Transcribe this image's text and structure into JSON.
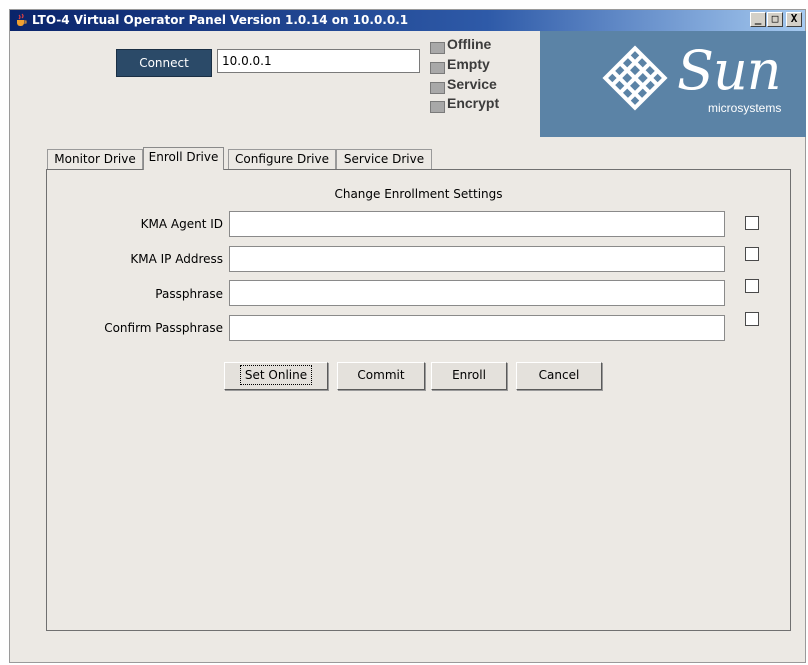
{
  "window": {
    "title": "LTO-4 Virtual Operator Panel Version 1.0.14 on 10.0.0.1",
    "controls": [
      "_",
      "□",
      "X"
    ]
  },
  "connection": {
    "connect_label": "Connect",
    "ip_value": "10.0.0.1"
  },
  "status": [
    {
      "label": "Offline"
    },
    {
      "label": "Empty"
    },
    {
      "label": "Service"
    },
    {
      "label": "Encrypt"
    }
  ],
  "logo": {
    "wordmark": "Sun",
    "subtitle": "microsystems",
    "background": "#5b83a6"
  },
  "tabs": [
    {
      "label": "Monitor Drive",
      "active": false
    },
    {
      "label": "Enroll Drive",
      "active": true
    },
    {
      "label": "Configure Drive",
      "active": false
    },
    {
      "label": "Service Drive",
      "active": false
    }
  ],
  "enroll": {
    "heading": "Change Enrollment Settings",
    "fields": [
      {
        "label": "KMA Agent ID",
        "value": "",
        "checked": false
      },
      {
        "label": "KMA IP Address",
        "value": "",
        "checked": false
      },
      {
        "label": "Passphrase",
        "value": "",
        "checked": false
      },
      {
        "label": "Confirm Passphrase",
        "value": "",
        "checked": false
      }
    ],
    "buttons": {
      "set_online": "Set Online",
      "commit": "Commit",
      "enroll": "Enroll",
      "cancel": "Cancel"
    }
  }
}
